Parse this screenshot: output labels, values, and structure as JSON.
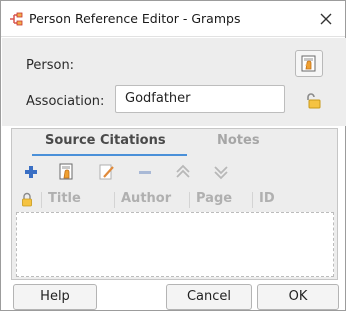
{
  "window": {
    "title": "Person Reference Editor - Gramps",
    "close_icon": "close-icon",
    "app_icon": "gramps-icon"
  },
  "form": {
    "person_label": "Person:",
    "person_button_icon": "select-person-icon",
    "association_label": "Association:",
    "association_value": "Godfather",
    "lock_icon": "unlocked-padlock-icon"
  },
  "tabs": [
    {
      "label": "Source Citations",
      "active": true
    },
    {
      "label": "Notes",
      "active": false
    }
  ],
  "toolbar": {
    "icons": [
      "add-icon",
      "share-existing-icon",
      "edit-icon",
      "remove-icon",
      "move-up-icon",
      "move-down-icon"
    ]
  },
  "table": {
    "columns": [
      "Title",
      "Author",
      "Page",
      "ID"
    ],
    "rows": []
  },
  "buttons": {
    "help": "Help",
    "cancel": "Cancel",
    "ok": "OK"
  },
  "colors": {
    "accent": "#4a90d9",
    "dialog_bg": "#ededed"
  }
}
